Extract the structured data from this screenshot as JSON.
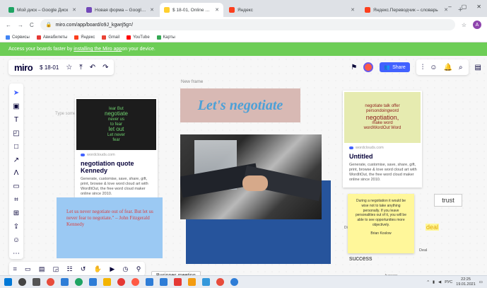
{
  "browser": {
    "tabs": [
      {
        "title": "Мой диск – Google Диск",
        "color": "#1fa463",
        "active": false
      },
      {
        "title": "Новая форма – Google Формы",
        "color": "#7248b9",
        "active": false
      },
      {
        "title": "$ 18-01, Online Whiteboard for",
        "color": "#ffd02f",
        "active": true
      },
      {
        "title": "Яндекс",
        "color": "#fc3f1d",
        "active": false
      },
      {
        "title": "Яндекс.Переводчик – словарь",
        "color": "#fc3f1d",
        "active": false
      }
    ],
    "new_tab": "+",
    "window_controls": [
      "–",
      "▢",
      "✕"
    ],
    "address": "miro.com/app/board/o9J_kgwrj5g=/",
    "bookmarks": [
      {
        "label": "Сервисы",
        "color": "#4285f4"
      },
      {
        "label": "Авиабилеты",
        "color": "#e53935"
      },
      {
        "label": "Яндекс",
        "color": "#fc3f1d"
      },
      {
        "label": "Gmail",
        "color": "#ea4335"
      },
      {
        "label": "YouTube",
        "color": "#ff0000"
      },
      {
        "label": "Карты",
        "color": "#34a853"
      }
    ],
    "profile_initial": "A"
  },
  "banner": {
    "prefix": "Access your boards faster by ",
    "link": "installing the Miro app",
    "suffix": " on your device."
  },
  "miro": {
    "logo": "miro",
    "board_name": "$ 18-01",
    "share_label": "Share"
  },
  "board": {
    "frame_label": "New frame",
    "hint": "Type some",
    "cloud1_words": [
      "lear But",
      "negotiate",
      "never us",
      "to fear",
      "let out",
      "Let never",
      "fear"
    ],
    "cloud2_words": [
      "negotiate talk offer",
      "persondoingword",
      "negotiation,",
      "make word",
      "wordWordOut Word"
    ],
    "card1": {
      "source": "wordclouds.com",
      "title": "negotiation quote Kennedy",
      "body": "Generate, customise, save, share, gift, print, browse & love word cloud art with WordItOut, the free word cloud maker online since 2010."
    },
    "card2": {
      "source": "wordclouds.com",
      "title": "Untitled",
      "body": "Generate, customise, save, share, gift, print, browse & love word cloud art with WordItOut, the free word cloud maker online since 2010."
    },
    "headline": "Let's negotiate",
    "quote": "Let us never negotiate out of fear. But let us never fear to negotiate.\" – John Fitzgerald Kennedy",
    "sticky": {
      "text": "During a negotiation it would be wise not to take anything personally. If you leave personalities out of it, you will be able to see opportunities more objectively.",
      "author": "Brian Koslow"
    },
    "trust": "trust",
    "deal": "deal",
    "deal_small": "Deal",
    "success": "success",
    "snip": "Di",
    "average": "Average",
    "bottom_frame": "Businnes meeting"
  },
  "taskbar": {
    "apps": [
      "#0078d7",
      "#444",
      "#555",
      "#e74c3c",
      "#2e7dd7",
      "#1fa463",
      "#2e7dd7",
      "#f4b400",
      "#e53935",
      "#ff5a45",
      "#2e7dd7",
      "#2e7dd7",
      "#e53935",
      "#f39c12",
      "#3498db",
      "#e74c3c",
      "#2e7dd7"
    ],
    "lang": "РУС",
    "time": "22:25",
    "date": "19.01.2021"
  }
}
